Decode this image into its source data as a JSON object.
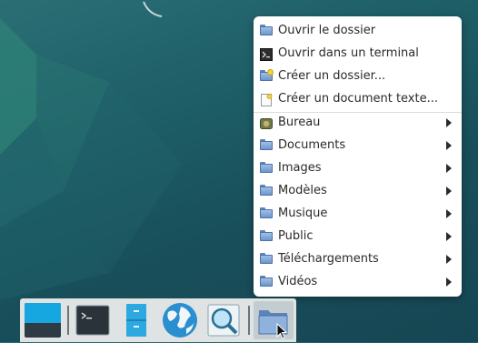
{
  "colors": {
    "menu_bg": "#ffffff",
    "menu_text": "#2a2a2a",
    "desktop_bg": "#1d5d66",
    "taskbar_bg": "#dfe3e4",
    "accent_blue": "#2ca9e1"
  },
  "context_menu": {
    "actions": [
      {
        "label": "Ouvrir le dossier",
        "icon": "folder-icon"
      },
      {
        "label": "Ouvrir dans un terminal",
        "icon": "terminal-icon"
      },
      {
        "label": "Créer un dossier...",
        "icon": "new-folder-icon"
      },
      {
        "label": "Créer un document texte...",
        "icon": "new-document-icon"
      }
    ],
    "places": [
      {
        "label": "Bureau",
        "icon": "desktop-icon"
      },
      {
        "label": "Documents",
        "icon": "folder-icon"
      },
      {
        "label": "Images",
        "icon": "folder-icon"
      },
      {
        "label": "Modèles",
        "icon": "folder-icon"
      },
      {
        "label": "Musique",
        "icon": "folder-icon"
      },
      {
        "label": "Public",
        "icon": "folder-icon"
      },
      {
        "label": "Téléchargements",
        "icon": "folder-icon"
      },
      {
        "label": "Vidéos",
        "icon": "folder-icon"
      }
    ]
  },
  "taskbar": {
    "launchers": [
      {
        "name": "show-desktop",
        "icon": "desktop-window-icon"
      },
      {
        "name": "terminal",
        "icon": "terminal-icon"
      },
      {
        "name": "file-manager",
        "icon": "file-cabinet-icon"
      },
      {
        "name": "web-browser",
        "icon": "globe-icon"
      },
      {
        "name": "app-finder",
        "icon": "magnifier-icon"
      },
      {
        "name": "places",
        "icon": "folder-icon"
      }
    ]
  }
}
